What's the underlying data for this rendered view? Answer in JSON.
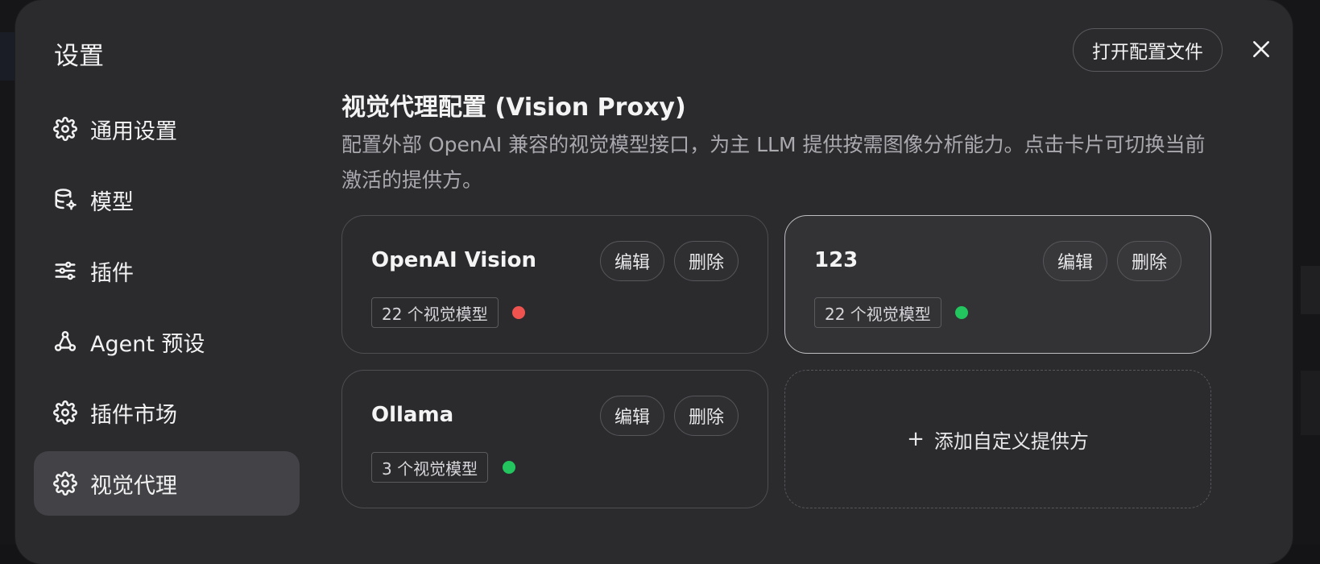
{
  "dialog": {
    "title": "设置",
    "open_config_label": "打开配置文件",
    "close_icon": "close-icon"
  },
  "sidebar": {
    "items": [
      {
        "label": "通用设置",
        "icon": "gear-icon",
        "active": false
      },
      {
        "label": "模型",
        "icon": "database-gear-icon",
        "active": false
      },
      {
        "label": "插件",
        "icon": "sliders-icon",
        "active": false
      },
      {
        "label": "Agent 预设",
        "icon": "share-nodes-icon",
        "active": false
      },
      {
        "label": "插件市场",
        "icon": "gear-icon",
        "active": false
      },
      {
        "label": "视觉代理",
        "icon": "gear-icon",
        "active": true
      }
    ]
  },
  "main": {
    "title": "视觉代理配置 (Vision Proxy)",
    "description": "配置外部 OpenAI 兼容的视觉模型接口，为主 LLM 提供按需图像分析能力。点击卡片可切换当前激活的提供方。",
    "edit_label": "编辑",
    "delete_label": "删除",
    "providers": [
      {
        "name": "OpenAI Vision",
        "models_badge": "22 个视觉模型",
        "status_color": "#ef5350",
        "active": false
      },
      {
        "name": "123",
        "models_badge": "22 个视觉模型",
        "status_color": "#22c55e",
        "active": true
      },
      {
        "name": "Ollama",
        "models_badge": "3 个视觉模型",
        "status_color": "#22c55e",
        "active": false
      }
    ],
    "add_provider": {
      "plus": "+",
      "label": "添加自定义提供方"
    }
  }
}
